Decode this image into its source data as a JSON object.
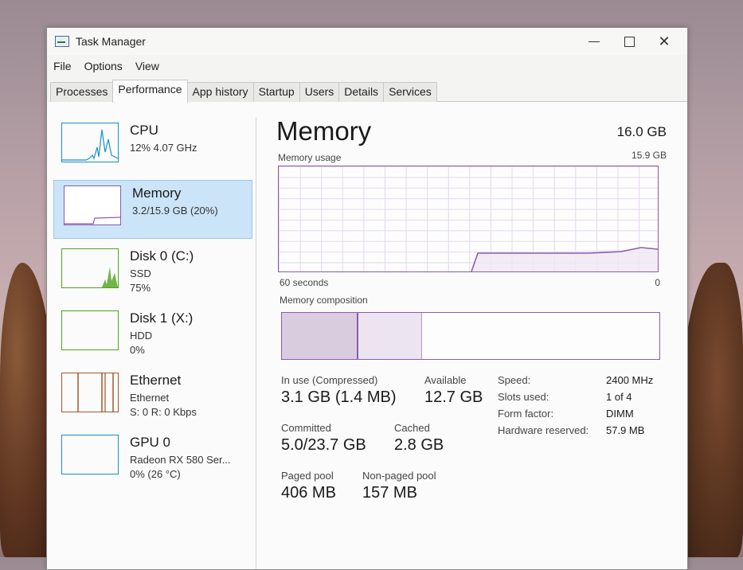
{
  "window": {
    "title": "Task Manager",
    "icon": "task-manager-icon"
  },
  "menu": [
    "File",
    "Options",
    "View"
  ],
  "tabs": [
    "Processes",
    "Performance",
    "App history",
    "Startup",
    "Users",
    "Details",
    "Services"
  ],
  "active_tab": "Performance",
  "sidebar": {
    "items": [
      {
        "name": "CPU",
        "line2": "12% 4.07 GHz",
        "line3": "",
        "graph_color": "#1790c9",
        "utilization_percent": 12
      },
      {
        "name": "Memory",
        "line2": "3.2/15.9 GB (20%)",
        "line3": "",
        "graph_color": "#8b5cb0",
        "utilization_percent": 20
      },
      {
        "name": "Disk 0 (C:)",
        "line2": "SSD",
        "line3": "75%",
        "graph_color": "#4da320",
        "utilization_percent": 75
      },
      {
        "name": "Disk 1 (X:)",
        "line2": "HDD",
        "line3": "0%",
        "graph_color": "#4da320",
        "utilization_percent": 0
      },
      {
        "name": "Ethernet",
        "line2": "Ethernet",
        "line3": "S: 0 R: 0 Kbps",
        "graph_color": "#a0582c",
        "utilization_percent": 0
      },
      {
        "name": "GPU 0",
        "line2": "Radeon RX 580 Ser...",
        "line3": "0% (26 °C)",
        "graph_color": "#1790c9",
        "utilization_percent": 0
      }
    ],
    "selected": "Memory"
  },
  "memory": {
    "title": "Memory",
    "total": "16.0 GB",
    "usage_label": "Memory usage",
    "usage_max": "15.9 GB",
    "axis_left": "60 seconds",
    "axis_right": "0",
    "composition_label": "Memory composition",
    "stats": {
      "in_use_label": "In use (Compressed)",
      "in_use_value": "3.1 GB (1.4 MB)",
      "available_label": "Available",
      "available_value": "12.7 GB",
      "committed_label": "Committed",
      "committed_value": "5.0/23.7 GB",
      "cached_label": "Cached",
      "cached_value": "2.8 GB",
      "paged_label": "Paged pool",
      "paged_value": "406 MB",
      "nonpaged_label": "Non-paged pool",
      "nonpaged_value": "157 MB"
    },
    "details": [
      {
        "label": "Speed:",
        "value": "2400 MHz"
      },
      {
        "label": "Slots used:",
        "value": "1 of 4"
      },
      {
        "label": "Form factor:",
        "value": "DIMM"
      },
      {
        "label": "Hardware reserved:",
        "value": "57.9 MB"
      }
    ],
    "accent_color": "#8b5cb0"
  }
}
